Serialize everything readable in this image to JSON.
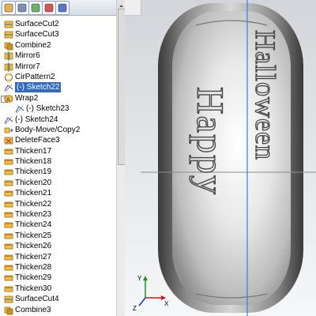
{
  "toolbar": {
    "buttons": [
      {
        "icon": "feature-manager-icon"
      },
      {
        "icon": "property-manager-icon"
      },
      {
        "icon": "configuration-manager-icon"
      },
      {
        "icon": "dimxpert-icon"
      },
      {
        "icon": "display-manager-icon"
      }
    ]
  },
  "tree": {
    "items": [
      {
        "label": "SurfaceCut2",
        "icon": "surface-cut-icon",
        "indent": 0
      },
      {
        "label": "SurfaceCut3",
        "icon": "surface-cut-icon",
        "indent": 0
      },
      {
        "label": "Combine2",
        "icon": "combine-icon",
        "indent": 0
      },
      {
        "label": "Mirror6",
        "icon": "mirror-icon",
        "indent": 0
      },
      {
        "label": "Mirror7",
        "icon": "mirror-icon",
        "indent": 0
      },
      {
        "label": "CirPattern2",
        "icon": "circular-pattern-icon",
        "indent": 0
      },
      {
        "label": "(-) Sketch22",
        "icon": "sketch-icon",
        "indent": 0,
        "selected": true
      },
      {
        "label": "Wrap2",
        "icon": "wrap-icon",
        "indent": 0,
        "expanded": true
      },
      {
        "label": "(-) Sketch23",
        "icon": "sketch-icon",
        "indent": 1
      },
      {
        "label": "(-) Sketch24",
        "icon": "sketch-icon",
        "indent": 0
      },
      {
        "label": "Body-Move/Copy2",
        "icon": "body-move-icon",
        "indent": 0
      },
      {
        "label": "DeleteFace3",
        "icon": "delete-face-icon",
        "indent": 0
      },
      {
        "label": "Thicken17",
        "icon": "thicken-icon",
        "indent": 0
      },
      {
        "label": "Thicken18",
        "icon": "thicken-icon",
        "indent": 0
      },
      {
        "label": "Thicken19",
        "icon": "thicken-icon",
        "indent": 0
      },
      {
        "label": "Thicken20",
        "icon": "thicken-icon",
        "indent": 0
      },
      {
        "label": "Thicken21",
        "icon": "thicken-icon",
        "indent": 0
      },
      {
        "label": "Thicken22",
        "icon": "thicken-icon",
        "indent": 0
      },
      {
        "label": "Thicken23",
        "icon": "thicken-icon",
        "indent": 0
      },
      {
        "label": "Thicken24",
        "icon": "thicken-icon",
        "indent": 0
      },
      {
        "label": "Thicken25",
        "icon": "thicken-icon",
        "indent": 0
      },
      {
        "label": "Thicken26",
        "icon": "thicken-icon",
        "indent": 0
      },
      {
        "label": "Thicken27",
        "icon": "thicken-icon",
        "indent": 0
      },
      {
        "label": "Thicken28",
        "icon": "thicken-icon",
        "indent": 0
      },
      {
        "label": "Thicken29",
        "icon": "thicken-icon",
        "indent": 0
      },
      {
        "label": "Thicken30",
        "icon": "thicken-icon",
        "indent": 0
      },
      {
        "label": "SurfaceCut4",
        "icon": "surface-cut-icon",
        "indent": 0
      },
      {
        "label": "Combine3",
        "icon": "combine-icon",
        "indent": 0
      }
    ]
  },
  "viewport": {
    "embossed_text_left": "Happy",
    "embossed_text_right": "Halloween",
    "triad_labels": {
      "x": "X",
      "y": "Y",
      "z": "Z"
    }
  },
  "colors": {
    "selection": "#316ac5",
    "axis_blue": "#2f7ff0",
    "triad_x": "#e01010",
    "triad_y": "#10a010",
    "triad_z": "#1030e0"
  }
}
